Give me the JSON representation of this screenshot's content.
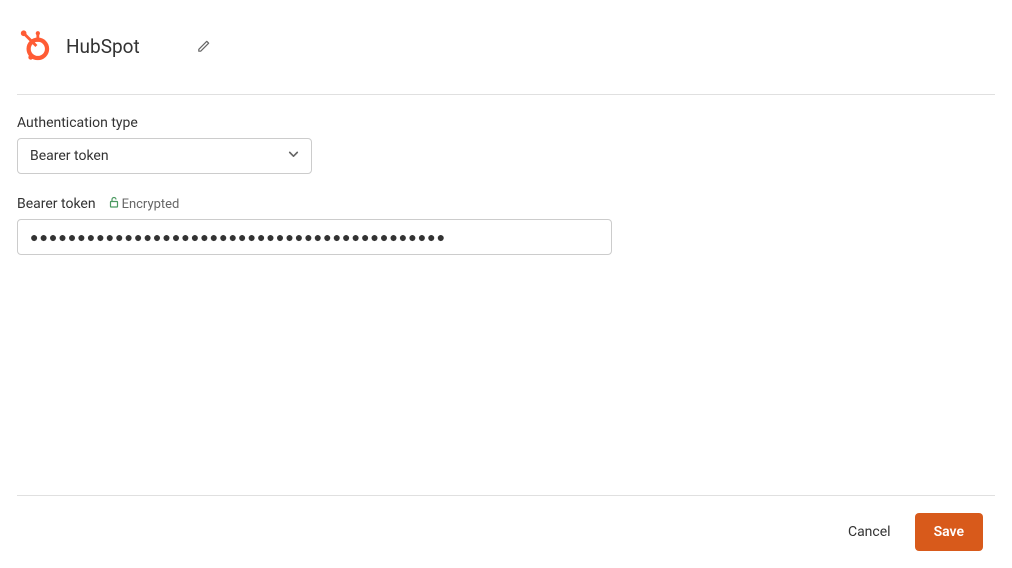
{
  "header": {
    "title": "HubSpot"
  },
  "form": {
    "auth_type_label": "Authentication type",
    "auth_type_value": "Bearer token",
    "bearer_token_label": "Bearer token",
    "encrypted_label": "Encrypted",
    "bearer_token_value": "●●●●●●●●●●●●●●●●●●●●●●●●●●●●●●●●●●●●●●●●●●●●"
  },
  "footer": {
    "cancel_label": "Cancel",
    "save_label": "Save"
  },
  "colors": {
    "accent": "#d85a1b",
    "hubspot_orange": "#ff5c35"
  }
}
